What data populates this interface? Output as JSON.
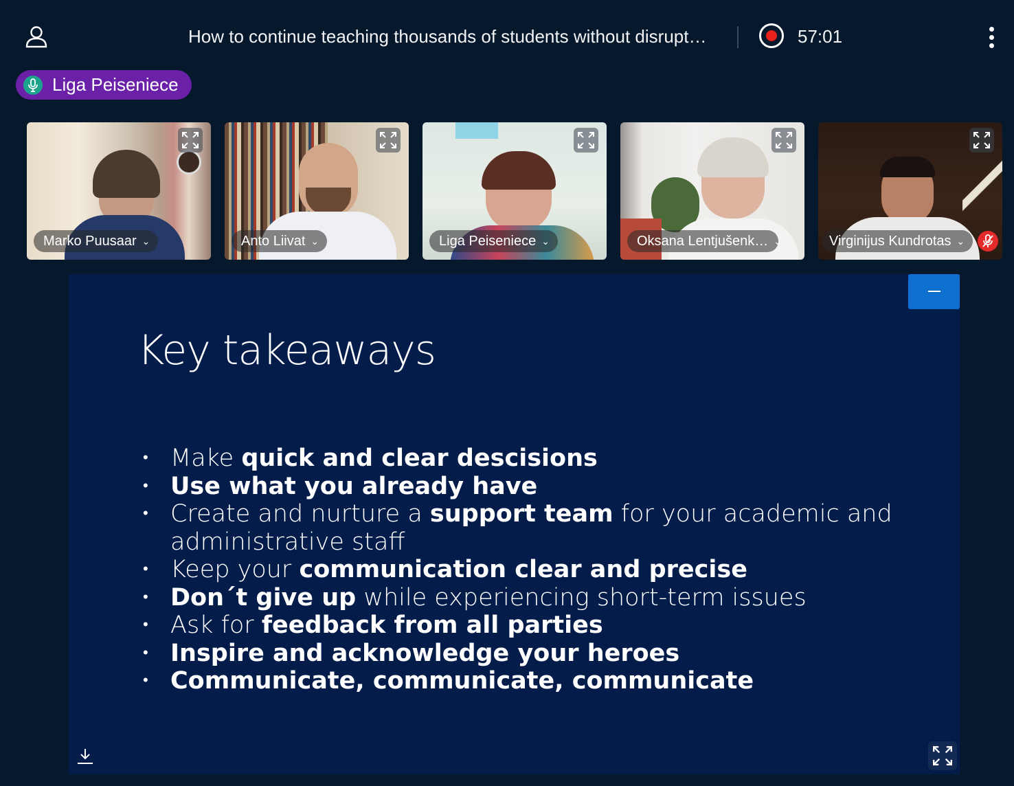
{
  "header": {
    "title": "How to continue teaching thousands of students without disrupti…",
    "timer": "57:01"
  },
  "talker": {
    "name": "Liga Peiseniece"
  },
  "participants": [
    {
      "name": "Marko Puusaar"
    },
    {
      "name": "Anto Liivat"
    },
    {
      "name": "Liga Peiseniece"
    },
    {
      "name": "Oksana Lentjušenk…"
    },
    {
      "name": "Virginijus Kundrotas"
    }
  ],
  "slide": {
    "title": "Key takeaways",
    "bullets": [
      {
        "parts": [
          {
            "t": "Make "
          },
          {
            "t": "quick and clear descisions",
            "b": true
          }
        ]
      },
      {
        "parts": [
          {
            "t": "Use what you already have",
            "b": true
          }
        ]
      },
      {
        "parts": [
          {
            "t": "Create and nurture a "
          },
          {
            "t": "support team",
            "b": true
          },
          {
            "t": " for your academic and administrative staff"
          }
        ]
      },
      {
        "parts": [
          {
            "t": "Keep your "
          },
          {
            "t": "communication clear and precise",
            "b": true
          }
        ]
      },
      {
        "parts": [
          {
            "t": "Don´t give up",
            "b": true
          },
          {
            "t": " while experiencing short-term issues"
          }
        ]
      },
      {
        "parts": [
          {
            "t": "Ask for "
          },
          {
            "t": "feedback from all parties",
            "b": true
          }
        ]
      },
      {
        "parts": [
          {
            "t": "Inspire and acknowledge your heroes",
            "b": true
          }
        ]
      },
      {
        "parts": [
          {
            "t": "Communicate, communicate, communicate",
            "b": true
          }
        ]
      }
    ]
  },
  "colors": {
    "background": "#06182b",
    "slide_background": "#041c4a",
    "talker_pill": "#6b20a8",
    "record_red": "#e8211d",
    "accent_blue": "#0f6fd1",
    "mute_red": "#e32b2b"
  },
  "icons": [
    "user-icon",
    "record-icon",
    "more-vertical-icon",
    "microphone-icon",
    "fullscreen-icon",
    "chevron-down-icon",
    "mic-muted-icon",
    "minimize-icon",
    "download-icon"
  ]
}
